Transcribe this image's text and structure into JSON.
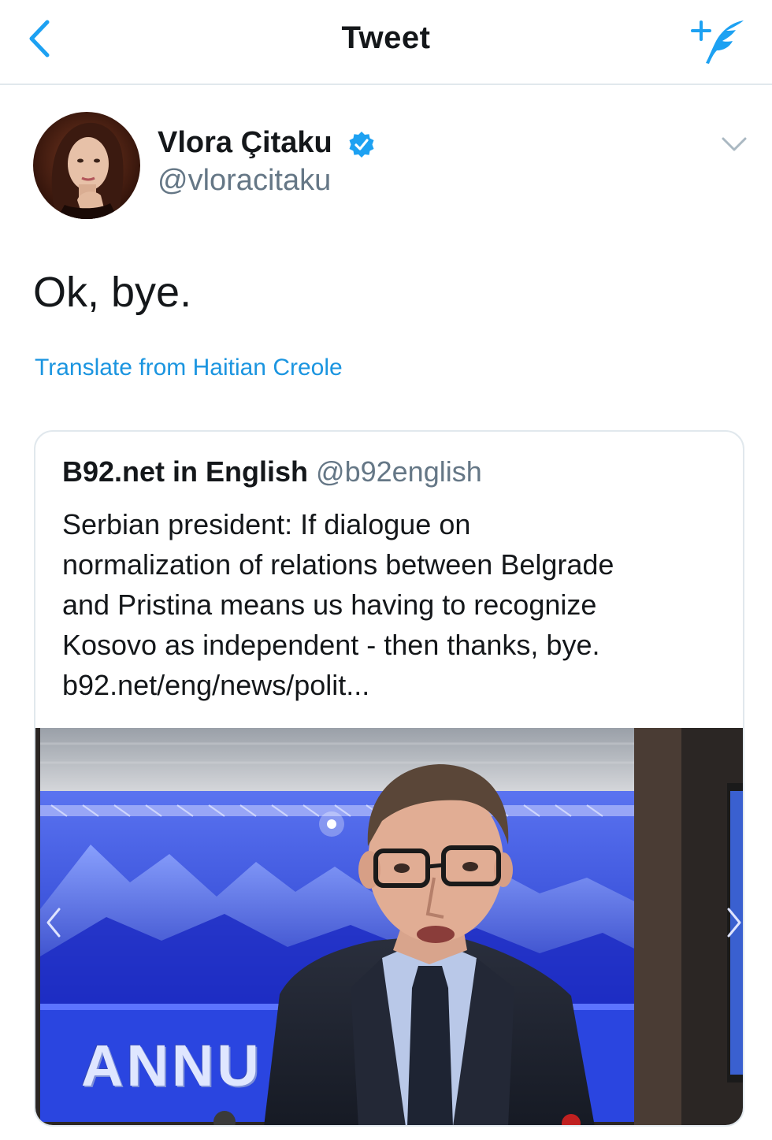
{
  "navbar": {
    "title": "Tweet",
    "back_icon": "chevron-left-icon",
    "compose_icon": "compose-tweet-icon",
    "accent_color": "#1da1f2"
  },
  "tweet": {
    "author": {
      "name": "Vlora Çitaku",
      "handle": "@vloracitaku",
      "verified": true,
      "verified_icon": "verified-badge-icon",
      "verified_color": "#1da1f2"
    },
    "more_icon": "chevron-down-icon",
    "text": "Ok, bye.",
    "translate_label": "Translate from Haitian Creole",
    "link_color": "#1b95e0"
  },
  "quoted_tweet": {
    "author_name": "B92.net in English",
    "author_handle": "@b92english",
    "text_lines": [
      "Serbian president: If dialogue on",
      "normalization of relations between Belgrade",
      "and Pristina means us having to recognize",
      "Kosovo as independent - then thanks, bye.",
      "b92.net/eng/news/polit..."
    ],
    "media": {
      "backdrop_sign_text": "ANNU",
      "prev_icon": "chevron-left-icon",
      "next_icon": "chevron-right-icon"
    }
  }
}
